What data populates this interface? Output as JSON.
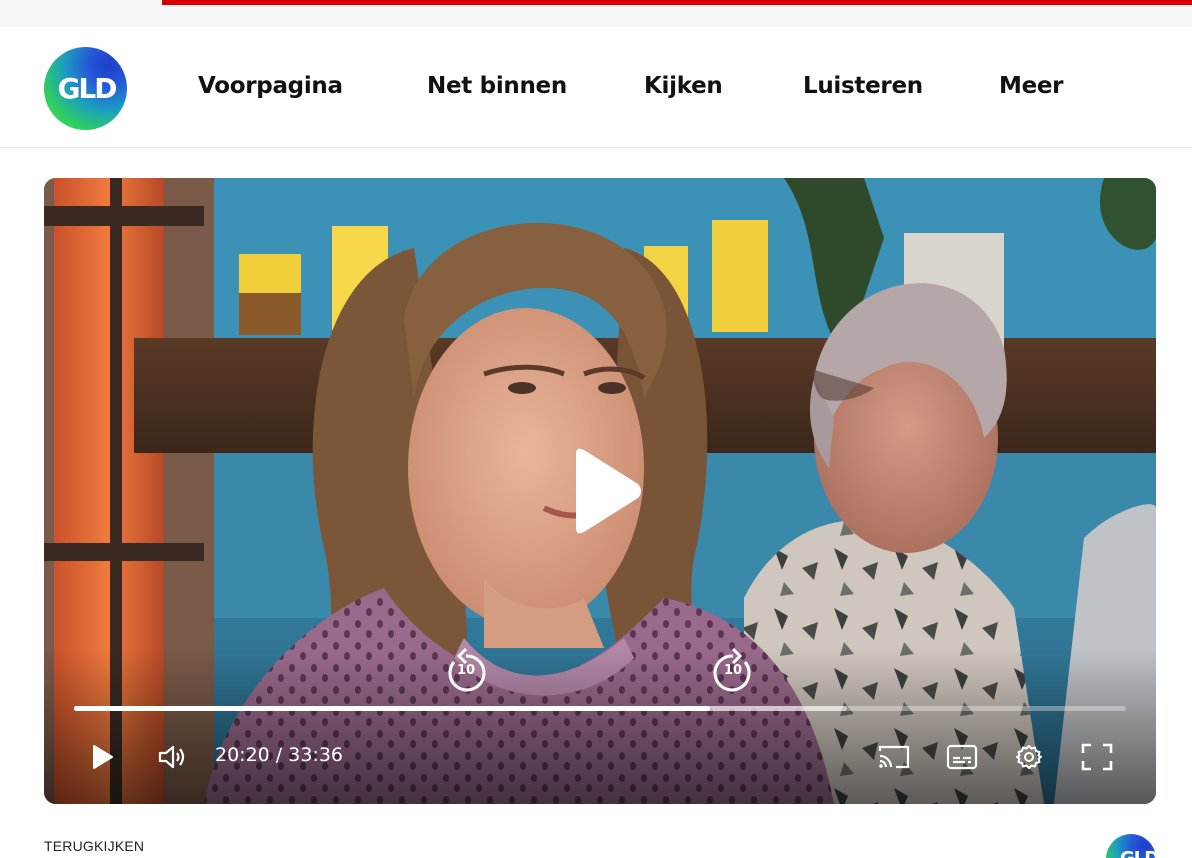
{
  "brand": {
    "logo_text": "GLD",
    "accent": "#d90000",
    "logo_gradient": [
      "#2457d6",
      "#1c9bc2",
      "#3ee23c"
    ]
  },
  "nav": {
    "items": [
      {
        "label": "Voorpagina"
      },
      {
        "label": "Net binnen"
      },
      {
        "label": "Kijken"
      },
      {
        "label": "Luisteren"
      },
      {
        "label": "Meer"
      }
    ]
  },
  "player": {
    "state": "paused",
    "skip_back_seconds": "10",
    "skip_forward_seconds": "10",
    "time_display": "20:20 / 33:36",
    "progress_fraction": 0.605,
    "buffered_fraction": 0.735,
    "icons": [
      "play-icon",
      "volume-icon",
      "cast-icon",
      "subtitles-icon",
      "settings-icon",
      "fullscreen-icon"
    ]
  },
  "section": {
    "label": "TERUGKIJKEN"
  }
}
